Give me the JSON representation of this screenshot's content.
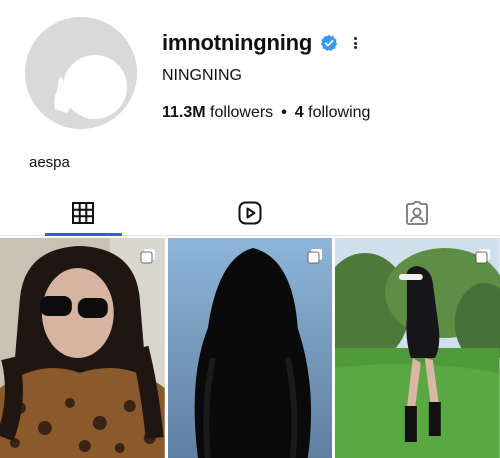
{
  "profile": {
    "username": "imnotningning",
    "display_name": "NINGNING",
    "followers_count": "11.3M",
    "followers_label": "followers",
    "separator": "•",
    "following_count": "4",
    "following_label": "following",
    "bio": "aespa",
    "verified": true
  },
  "tabs": [
    {
      "icon": "grid-icon",
      "active": true
    },
    {
      "icon": "reels-icon",
      "active": false
    },
    {
      "icon": "tagged-icon",
      "active": false
    }
  ],
  "posts": [
    {
      "icon": "multi-post-icon"
    },
    {
      "icon": "multi-post-icon"
    },
    {
      "icon": "multi-post-icon"
    }
  ],
  "colors": {
    "accent": "#3b5bdb",
    "verified": "#3797f0"
  }
}
